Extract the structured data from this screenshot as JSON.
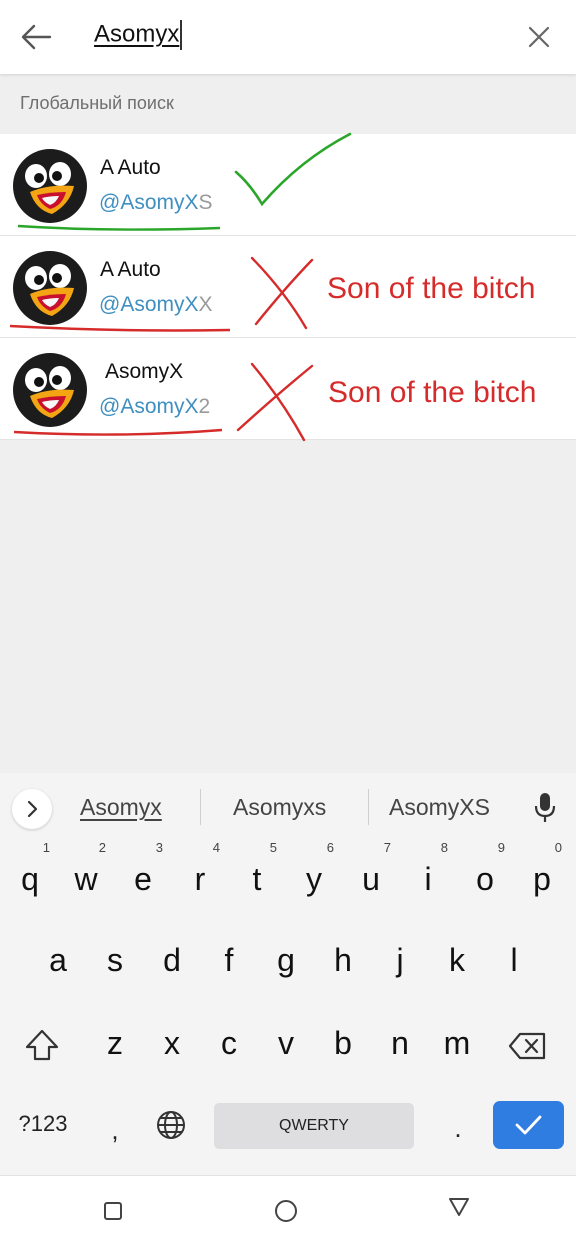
{
  "search": {
    "query": "Asomyx"
  },
  "section": {
    "title": "Глобальный поиск"
  },
  "results": [
    {
      "name": "A Auto",
      "handle_match": "@AsomyX",
      "handle_rest": "S"
    },
    {
      "name": "A Auto",
      "handle_match": "@AsomyX",
      "handle_rest": "X"
    },
    {
      "name": "AsomyX",
      "handle_match": "@AsomyX",
      "handle_rest": "2"
    }
  ],
  "annotations": {
    "row2_note": "Son of the bitch",
    "row3_note": "Son of the bitch",
    "colors": {
      "check": "#2aa62a",
      "cross": "#d62b2b",
      "note": "#d62b2b"
    }
  },
  "keyboard": {
    "suggestions": [
      "Asomyx",
      "Asomyxs",
      "AsomyXS"
    ],
    "row1": [
      "q",
      "w",
      "e",
      "r",
      "t",
      "y",
      "u",
      "i",
      "o",
      "p"
    ],
    "row1_nums": [
      "1",
      "2",
      "3",
      "4",
      "5",
      "6",
      "7",
      "8",
      "9",
      "0"
    ],
    "row2": [
      "a",
      "s",
      "d",
      "f",
      "g",
      "h",
      "j",
      "k",
      "l"
    ],
    "row3": [
      "z",
      "x",
      "c",
      "v",
      "b",
      "n",
      "m"
    ],
    "symbols_label": "?123",
    "comma": ",",
    "space_label": "QWERTY",
    "period": "."
  },
  "accent_color": "#2f7de1"
}
